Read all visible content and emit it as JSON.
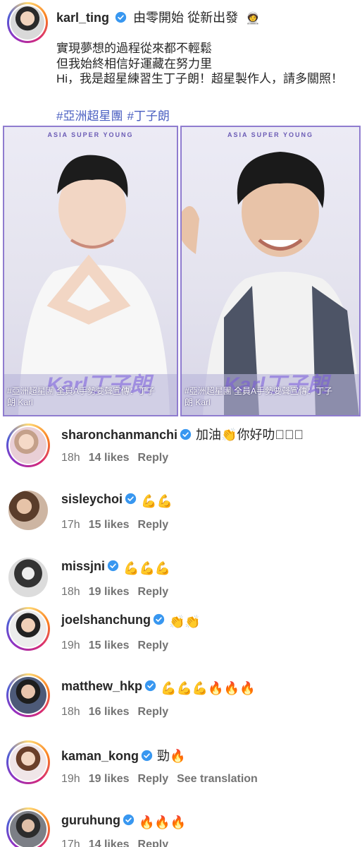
{
  "post": {
    "username": "karl_ting",
    "headline": "由零開始 從新出發",
    "caption_lines": [
      "實現夢想的過程從來都不輕鬆",
      "但我始終相信好運藏在努力里",
      "Hi，我是超星練習生丁子朗！超星製作人，請多關照！"
    ],
    "hashtags": [
      "#亞洲超星團",
      "#丁子朗"
    ],
    "images": [
      {
        "title": "ASIA SUPER YOUNG",
        "watermark": "Karl丁子朗",
        "caption_line1": "#亞洲超星團 全員A手勢要聲宣傳：丁子",
        "caption_line2": "朗 Karl"
      },
      {
        "title": "ASIA SUPER YOUNG",
        "watermark": "Karl丁子朗",
        "caption_line1": "#亞洲超星團 全員A手勢要聲宣傳：丁子",
        "caption_line2": "朗 Karl"
      }
    ]
  },
  "comments": [
    {
      "username": "sharonchanmanchi",
      "text": "加油👏你好叻叻🏻🏻",
      "time": "18h",
      "likes": "14 likes",
      "reply": "Reply",
      "story_ring": true,
      "emoji": ""
    },
    {
      "username": "sisleychoi",
      "text": "",
      "time": "17h",
      "likes": "15 likes",
      "reply": "Reply",
      "story_ring": false,
      "emoji": "💪💪"
    },
    {
      "username": "missjni",
      "text": "",
      "time": "18h",
      "likes": "19 likes",
      "reply": "Reply",
      "story_ring": false,
      "emoji": "💪💪💪"
    },
    {
      "username": "joelshanchung",
      "text": "",
      "time": "19h",
      "likes": "15 likes",
      "reply": "Reply",
      "story_ring": true,
      "emoji": "👏👏"
    },
    {
      "username": "matthew_hkp",
      "text": "",
      "time": "18h",
      "likes": "16 likes",
      "reply": "Reply",
      "story_ring": true,
      "emoji": "💪💪💪🔥🔥🔥"
    },
    {
      "username": "kaman_kong",
      "text": "勁🔥",
      "time": "19h",
      "likes": "19 likes",
      "reply": "Reply",
      "translate": "See translation",
      "story_ring": true,
      "emoji": ""
    },
    {
      "username": "guruhung",
      "text": "",
      "time": "17h",
      "likes": "14 likes",
      "reply": "Reply",
      "story_ring": true,
      "emoji": "🔥🔥🔥"
    }
  ],
  "colors": {
    "verified": "#3897f0",
    "hashtag": "#4a5fc1",
    "meta": "#737373",
    "poster_border": "#8f7ccf"
  },
  "icons": {
    "verified": "verified-badge-icon",
    "headline_emoji": "person-emoji-icon"
  }
}
